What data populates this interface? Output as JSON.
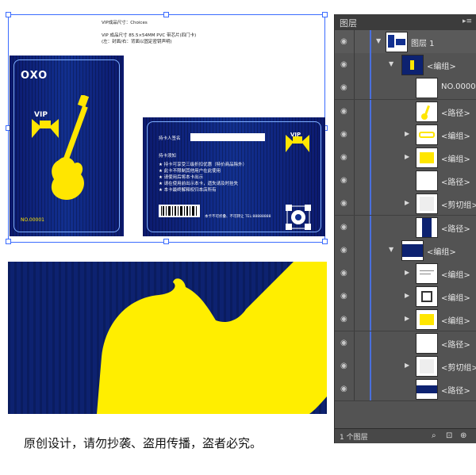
{
  "artboard": {
    "spec_lines": [
      "VIP成品尺寸：Choices",
      "VIP 成品尺寸 85.5×54MM PVC 带芯片(四门卡)",
      "(左：封面/右：背面以固定密钥声明)"
    ],
    "card_front": {
      "logo_text": "OXO",
      "vip_text": "VIP",
      "number": "NO.00001"
    },
    "card_back": {
      "signature_label": "持卡人签名",
      "notice_title": "持卡须知",
      "notice_lines": [
        "★ 持卡可享受三级折扣优惠（特价商品除外）",
        "★ 此卡不限制其他用户在此使用",
        "★ 请使用后将本卡出示",
        "★ 请在使用前出示本卡，遗失请及时挂失",
        "★ 本卡最终解释权归本店所有"
      ],
      "vip_text": "VIP",
      "footer": "本卡不可折叠、不可转让 TEL:88888888"
    }
  },
  "layers_panel": {
    "tab_label": "图层",
    "menu_icon": "panel-menu-icon",
    "rows": [
      {
        "label": "图层 1",
        "indent": 0,
        "expanded": true,
        "thumb": "artboard"
      },
      {
        "label": "<编组>",
        "indent": 1,
        "expanded": true,
        "thumb": "card-front"
      },
      {
        "label": "NO.00001",
        "indent": 2,
        "expanded": null,
        "thumb": "text"
      },
      {
        "label": "<路径>",
        "indent": 2,
        "expanded": null,
        "thumb": "guitar"
      },
      {
        "label": "<编组>",
        "indent": 2,
        "expanded": false,
        "thumb": "logo"
      },
      {
        "label": "<编组>",
        "indent": 2,
        "expanded": false,
        "thumb": "vip"
      },
      {
        "label": "<路径>",
        "indent": 2,
        "expanded": null,
        "thumb": "blank"
      },
      {
        "label": "<剪切组>",
        "indent": 2,
        "expanded": false,
        "thumb": "blank-grey"
      },
      {
        "label": "<路径>",
        "indent": 2,
        "expanded": null,
        "thumb": "dark"
      },
      {
        "label": "<编组>",
        "indent": 1,
        "expanded": true,
        "thumb": "card-back"
      },
      {
        "label": "<编组>",
        "indent": 2,
        "expanded": false,
        "thumb": "text-lines"
      },
      {
        "label": "<编组>",
        "indent": 2,
        "expanded": false,
        "thumb": "pattern"
      },
      {
        "label": "<编组>",
        "indent": 2,
        "expanded": false,
        "thumb": "vip"
      },
      {
        "label": "<路径>",
        "indent": 2,
        "expanded": null,
        "thumb": "blank"
      },
      {
        "label": "<剪切组>",
        "indent": 2,
        "expanded": false,
        "thumb": "blank-grey"
      },
      {
        "label": "<路径>",
        "indent": 2,
        "expanded": null,
        "thumb": "dark-wide"
      }
    ],
    "footer_count": "1 个图层"
  },
  "zoom_preview": {
    "colors": {
      "background": "#0d2270",
      "guitar": "#ffee00"
    }
  },
  "caption": "原创设计，请勿抄袭、盗用传播，盗者必究。"
}
